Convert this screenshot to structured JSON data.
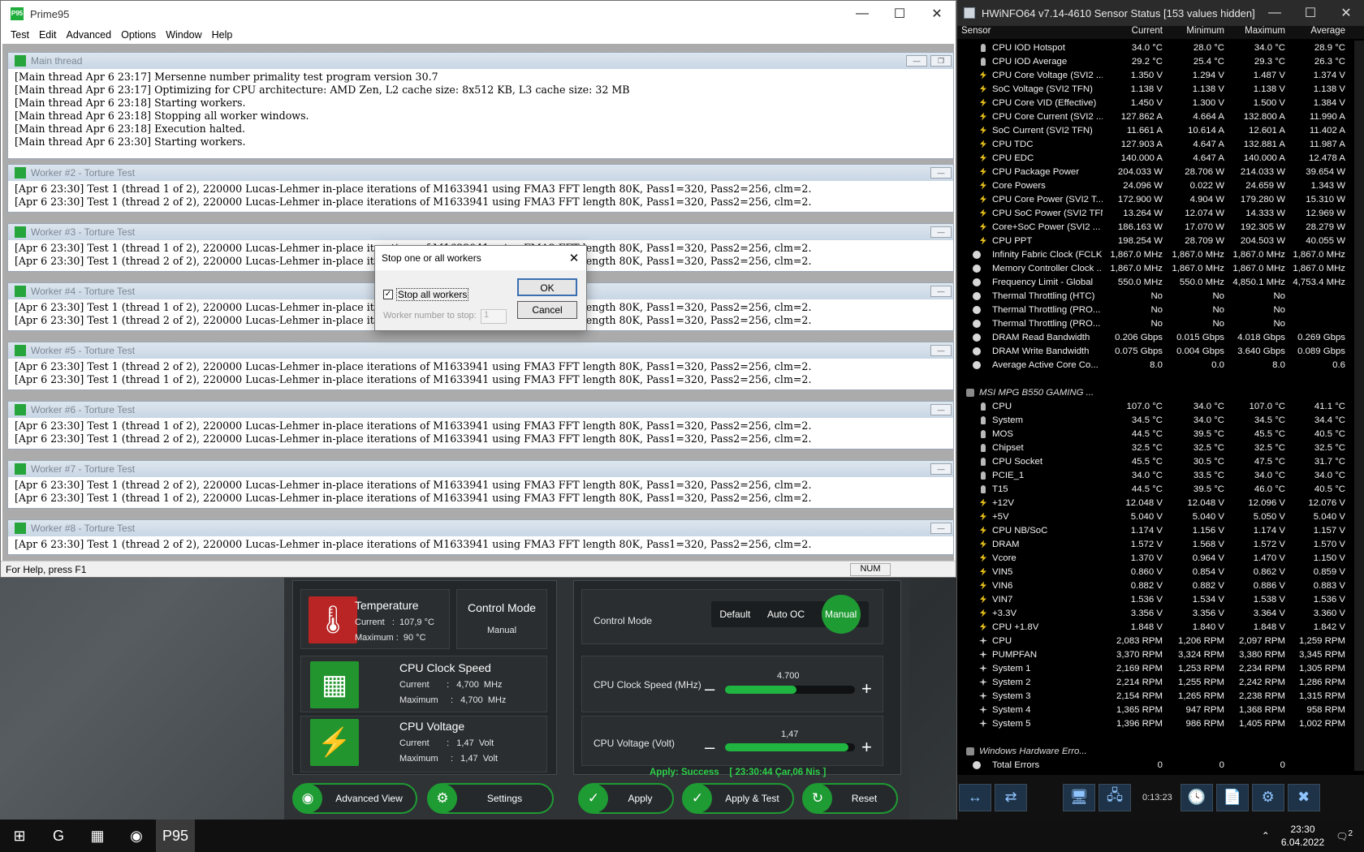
{
  "prime95": {
    "title": "Prime95",
    "menu": [
      "Test",
      "Edit",
      "Advanced",
      "Options",
      "Window",
      "Help"
    ],
    "status": "For Help, press F1",
    "status_num": "NUM",
    "main_thread": {
      "title": "Main thread",
      "lines": [
        "[Main thread Apr 6 23:17] Mersenne number primality test program version 30.7",
        "[Main thread Apr 6 23:17] Optimizing for CPU architecture: AMD Zen, L2 cache size: 8x512 KB, L3 cache size: 32 MB",
        "[Main thread Apr 6 23:18] Starting workers.",
        "[Main thread Apr 6 23:18] Stopping all worker windows.",
        "[Main thread Apr 6 23:18] Execution halted.",
        "[Main thread Apr 6 23:30] Starting workers."
      ]
    },
    "workers": [
      {
        "title": "Worker #2 - Torture Test",
        "lines": [
          "[Apr 6 23:30] Test 1 (thread 1 of 2), 220000 Lucas-Lehmer in-place iterations of M1633941 using FMA3 FFT length 80K, Pass1=320, Pass2=256, clm=2.",
          "[Apr 6 23:30] Test 1 (thread 2 of 2), 220000 Lucas-Lehmer in-place iterations of M1633941 using FMA3 FFT length 80K, Pass1=320, Pass2=256, clm=2."
        ]
      },
      {
        "title": "Worker #3 - Torture Test",
        "lines": [
          "[Apr 6 23:30] Test 1 (thread 1 of 2), 220000 Lucas-Lehmer in-place iterations of M1633941 using FMA3 FFT length 80K, Pass1=320, Pass2=256, clm=2.",
          "[Apr 6 23:30] Test 1 (thread 2 of 2), 220000 Lucas-Lehmer in-place iterations of M1633941 using FMA3 FFT length 80K, Pass1=320, Pass2=256, clm=2."
        ]
      },
      {
        "title": "Worker #4 - Torture Test",
        "lines": [
          "[Apr 6 23:30] Test 1 (thread 1 of 2), 220000 Lucas-Lehmer in-place iterations of M1633941 using FMA3 FFT length 80K, Pass1=320, Pass2=256, clm=2.",
          "[Apr 6 23:30] Test 1 (thread 2 of 2), 220000 Lucas-Lehmer in-place iterations of M1633941 using FMA3 FFT length 80K, Pass1=320, Pass2=256, clm=2."
        ]
      },
      {
        "title": "Worker #5 - Torture Test",
        "lines": [
          "[Apr 6 23:30] Test 1 (thread 2 of 2), 220000 Lucas-Lehmer in-place iterations of M1633941 using FMA3 FFT length 80K, Pass1=320, Pass2=256, clm=2.",
          "[Apr 6 23:30] Test 1 (thread 1 of 2), 220000 Lucas-Lehmer in-place iterations of M1633941 using FMA3 FFT length 80K, Pass1=320, Pass2=256, clm=2."
        ]
      },
      {
        "title": "Worker #6 - Torture Test",
        "lines": [
          "[Apr 6 23:30] Test 1 (thread 1 of 2), 220000 Lucas-Lehmer in-place iterations of M1633941 using FMA3 FFT length 80K, Pass1=320, Pass2=256, clm=2.",
          "[Apr 6 23:30] Test 1 (thread 2 of 2), 220000 Lucas-Lehmer in-place iterations of M1633941 using FMA3 FFT length 80K, Pass1=320, Pass2=256, clm=2."
        ]
      },
      {
        "title": "Worker #7 - Torture Test",
        "lines": [
          "[Apr 6 23:30] Test 1 (thread 2 of 2), 220000 Lucas-Lehmer in-place iterations of M1633941 using FMA3 FFT length 80K, Pass1=320, Pass2=256, clm=2.",
          "[Apr 6 23:30] Test 1 (thread 1 of 2), 220000 Lucas-Lehmer in-place iterations of M1633941 using FMA3 FFT length 80K, Pass1=320, Pass2=256, clm=2."
        ]
      },
      {
        "title": "Worker #8 - Torture Test",
        "lines": [
          "[Apr 6 23:30] Test 1 (thread 2 of 2), 220000 Lucas-Lehmer in-place iterations of M1633941 using FMA3 FFT length 80K, Pass1=320, Pass2=256, clm=2."
        ]
      }
    ]
  },
  "dialog": {
    "title": "Stop one or all workers",
    "checkbox_label": "Stop all workers",
    "worker_label": "Worker number to stop:",
    "worker_value": "1",
    "ok": "OK",
    "cancel": "Cancel"
  },
  "oc": {
    "temperature": {
      "title": "Temperature",
      "current": "Current   :  107,9 °C",
      "maximum": "Maximum :  90 °C"
    },
    "control_mode": {
      "title": "Control Mode",
      "value": "Manual"
    },
    "clock": {
      "title": "CPU Clock Speed",
      "current": "Current       :   4,700  MHz",
      "maximum": "Maximum     :   4,700  MHz"
    },
    "voltage": {
      "title": "CPU Voltage",
      "current": "Current       :   1,47  Volt",
      "maximum": "Maximum     :   1,47  Volt"
    },
    "right_control_label": "Control Mode",
    "modes": [
      "Default",
      "Auto OC",
      "Manual"
    ],
    "clock_label": "CPU Clock Speed (MHz)",
    "clock_value": "4.700",
    "clock_fill": 0.55,
    "volt_label": "CPU Voltage (Volt)",
    "volt_value": "1,47",
    "volt_fill": 0.95,
    "apply_status": "Apply: Success    [ 23:30:44 Çar,06 Nis ]",
    "buttons": [
      "Advanced View",
      "Settings",
      "Apply",
      "Apply & Test",
      "Reset"
    ]
  },
  "hwinfo": {
    "title": "HWiNFO64 v7.14-4610 Sensor Status [153 values hidden]",
    "columns": [
      "Sensor",
      "Current",
      "Minimum",
      "Maximum",
      "Average"
    ],
    "rows": [
      [
        "temp",
        "CPU IOD Hotspot",
        "34.0 °C",
        "28.0 °C",
        "34.0 °C",
        "28.9 °C"
      ],
      [
        "temp",
        "CPU IOD Average",
        "29.2 °C",
        "25.4 °C",
        "29.3 °C",
        "26.3 °C"
      ],
      [
        "volt",
        "CPU Core Voltage (SVI2 ...",
        "1.350 V",
        "1.294 V",
        "1.487 V",
        "1.374 V"
      ],
      [
        "volt",
        "SoC Voltage (SVI2 TFN)",
        "1.138 V",
        "1.138 V",
        "1.138 V",
        "1.138 V"
      ],
      [
        "volt",
        "CPU Core VID (Effective)",
        "1.450 V",
        "1.300 V",
        "1.500 V",
        "1.384 V"
      ],
      [
        "volt",
        "CPU Core Current (SVI2 ...",
        "127.862 A",
        "4.664 A",
        "132.800 A",
        "11.990 A"
      ],
      [
        "volt",
        "SoC Current (SVI2 TFN)",
        "11.661 A",
        "10.614 A",
        "12.601 A",
        "11.402 A"
      ],
      [
        "volt",
        "CPU TDC",
        "127.903 A",
        "4.647 A",
        "132.881 A",
        "11.987 A"
      ],
      [
        "volt",
        "CPU EDC",
        "140.000 A",
        "4.647 A",
        "140.000 A",
        "12.478 A"
      ],
      [
        "volt",
        "CPU Package Power",
        "204.033 W",
        "28.706 W",
        "214.033 W",
        "39.654 W"
      ],
      [
        "volt",
        "Core Powers",
        "24.096 W",
        "0.022 W",
        "24.659 W",
        "1.343 W"
      ],
      [
        "volt",
        "CPU Core Power (SVI2 T...",
        "172.900 W",
        "4.904 W",
        "179.280 W",
        "15.310 W"
      ],
      [
        "volt",
        "CPU SoC Power (SVI2 TFN)",
        "13.264 W",
        "12.074 W",
        "14.333 W",
        "12.969 W"
      ],
      [
        "volt",
        "Core+SoC Power (SVI2 ...",
        "186.163 W",
        "17.070 W",
        "192.305 W",
        "28.279 W"
      ],
      [
        "volt",
        "CPU PPT",
        "198.254 W",
        "28.709 W",
        "204.503 W",
        "40.055 W"
      ],
      [
        "clock",
        "Infinity Fabric Clock (FCLK)",
        "1,867.0 MHz",
        "1,867.0 MHz",
        "1,867.0 MHz",
        "1,867.0 MHz"
      ],
      [
        "clock",
        "Memory Controller Clock ...",
        "1,867.0 MHz",
        "1,867.0 MHz",
        "1,867.0 MHz",
        "1,867.0 MHz"
      ],
      [
        "clock",
        "Frequency Limit - Global",
        "550.0 MHz",
        "550.0 MHz",
        "4,850.1 MHz",
        "4,753.4 MHz"
      ],
      [
        "clock",
        "Thermal Throttling (HTC)",
        "No",
        "No",
        "No",
        ""
      ],
      [
        "clock",
        "Thermal Throttling (PRO...",
        "No",
        "No",
        "No",
        ""
      ],
      [
        "clock",
        "Thermal Throttling (PRO...",
        "No",
        "No",
        "No",
        ""
      ],
      [
        "clock",
        "DRAM Read Bandwidth",
        "0.206 Gbps",
        "0.015 Gbps",
        "4.018 Gbps",
        "0.269 Gbps"
      ],
      [
        "clock",
        "DRAM Write Bandwidth",
        "0.075 Gbps",
        "0.004 Gbps",
        "3.640 Gbps",
        "0.089 Gbps"
      ],
      [
        "clock",
        "Average Active Core Co...",
        "8.0",
        "0.0",
        "8.0",
        "0.6"
      ],
      [
        "blank",
        "",
        "",
        "",
        "",
        ""
      ],
      [
        "grp",
        "MSI MPG B550 GAMING ...",
        "",
        "",
        "",
        ""
      ],
      [
        "temp",
        "CPU",
        "107.0 °C",
        "34.0 °C",
        "107.0 °C",
        "41.1 °C"
      ],
      [
        "temp",
        "System",
        "34.5 °C",
        "34.0 °C",
        "34.5 °C",
        "34.4 °C"
      ],
      [
        "temp",
        "MOS",
        "44.5 °C",
        "39.5 °C",
        "45.5 °C",
        "40.5 °C"
      ],
      [
        "temp",
        "Chipset",
        "32.5 °C",
        "32.5 °C",
        "32.5 °C",
        "32.5 °C"
      ],
      [
        "temp",
        "CPU Socket",
        "45.5 °C",
        "30.5 °C",
        "47.5 °C",
        "31.7 °C"
      ],
      [
        "temp",
        "PCIE_1",
        "34.0 °C",
        "33.5 °C",
        "34.0 °C",
        "34.0 °C"
      ],
      [
        "temp",
        "T15",
        "44.5 °C",
        "39.5 °C",
        "46.0 °C",
        "40.5 °C"
      ],
      [
        "volt",
        "+12V",
        "12.048 V",
        "12.048 V",
        "12.096 V",
        "12.076 V"
      ],
      [
        "volt",
        "+5V",
        "5.040 V",
        "5.040 V",
        "5.050 V",
        "5.040 V"
      ],
      [
        "volt",
        "CPU NB/SoC",
        "1.174 V",
        "1.156 V",
        "1.174 V",
        "1.157 V"
      ],
      [
        "volt",
        "DRAM",
        "1.572 V",
        "1.568 V",
        "1.572 V",
        "1.570 V"
      ],
      [
        "volt",
        "Vcore",
        "1.370 V",
        "0.964 V",
        "1.470 V",
        "1.150 V"
      ],
      [
        "volt",
        "VIN5",
        "0.860 V",
        "0.854 V",
        "0.862 V",
        "0.859 V"
      ],
      [
        "volt",
        "VIN6",
        "0.882 V",
        "0.882 V",
        "0.886 V",
        "0.883 V"
      ],
      [
        "volt",
        "VIN7",
        "1.536 V",
        "1.534 V",
        "1.538 V",
        "1.536 V"
      ],
      [
        "volt",
        "+3.3V",
        "3.356 V",
        "3.356 V",
        "3.364 V",
        "3.360 V"
      ],
      [
        "volt",
        "CPU +1.8V",
        "1.848 V",
        "1.840 V",
        "1.848 V",
        "1.842 V"
      ],
      [
        "fan",
        "CPU",
        "2,083 RPM",
        "1,206 RPM",
        "2,097 RPM",
        "1,259 RPM"
      ],
      [
        "fan",
        "PUMPFAN",
        "3,370 RPM",
        "3,324 RPM",
        "3,380 RPM",
        "3,345 RPM"
      ],
      [
        "fan",
        "System 1",
        "2,169 RPM",
        "1,253 RPM",
        "2,234 RPM",
        "1,305 RPM"
      ],
      [
        "fan",
        "System 2",
        "2,214 RPM",
        "1,255 RPM",
        "2,242 RPM",
        "1,286 RPM"
      ],
      [
        "fan",
        "System 3",
        "2,154 RPM",
        "1,265 RPM",
        "2,238 RPM",
        "1,315 RPM"
      ],
      [
        "fan",
        "System 4",
        "1,365 RPM",
        "947 RPM",
        "1,368 RPM",
        "958 RPM"
      ],
      [
        "fan",
        "System 5",
        "1,396 RPM",
        "986 RPM",
        "1,405 RPM",
        "1,002 RPM"
      ],
      [
        "blank",
        "",
        "",
        "",
        "",
        ""
      ],
      [
        "grp",
        "Windows Hardware Erro...",
        "",
        "",
        "",
        ""
      ],
      [
        "clock",
        "Total Errors",
        "0",
        "0",
        "0",
        ""
      ]
    ],
    "timer": "0:13:23"
  },
  "taskbar": {
    "time": "23:30",
    "date": "6.04.2022",
    "notifications": "2"
  }
}
